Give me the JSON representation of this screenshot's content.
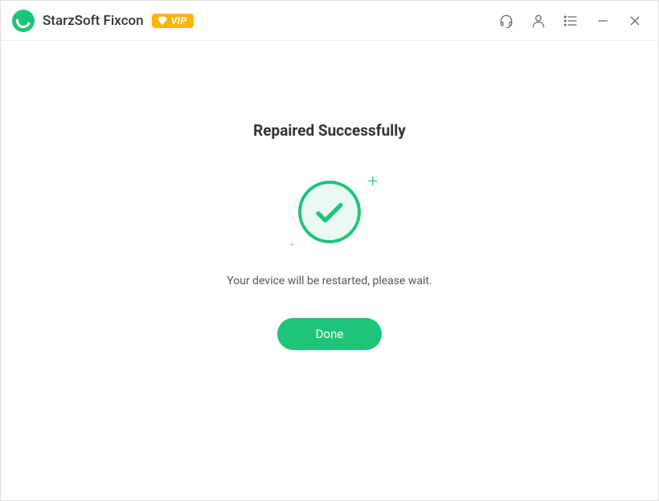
{
  "header": {
    "app_title": "StarzSoft Fixcon",
    "vip_label": "VIP"
  },
  "main": {
    "status_heading": "Repaired Successfully",
    "status_message": "Your device will be restarted, please wait.",
    "done_button_label": "Done"
  },
  "colors": {
    "accent": "#1ec579",
    "vip_badge": "#ffb400"
  }
}
